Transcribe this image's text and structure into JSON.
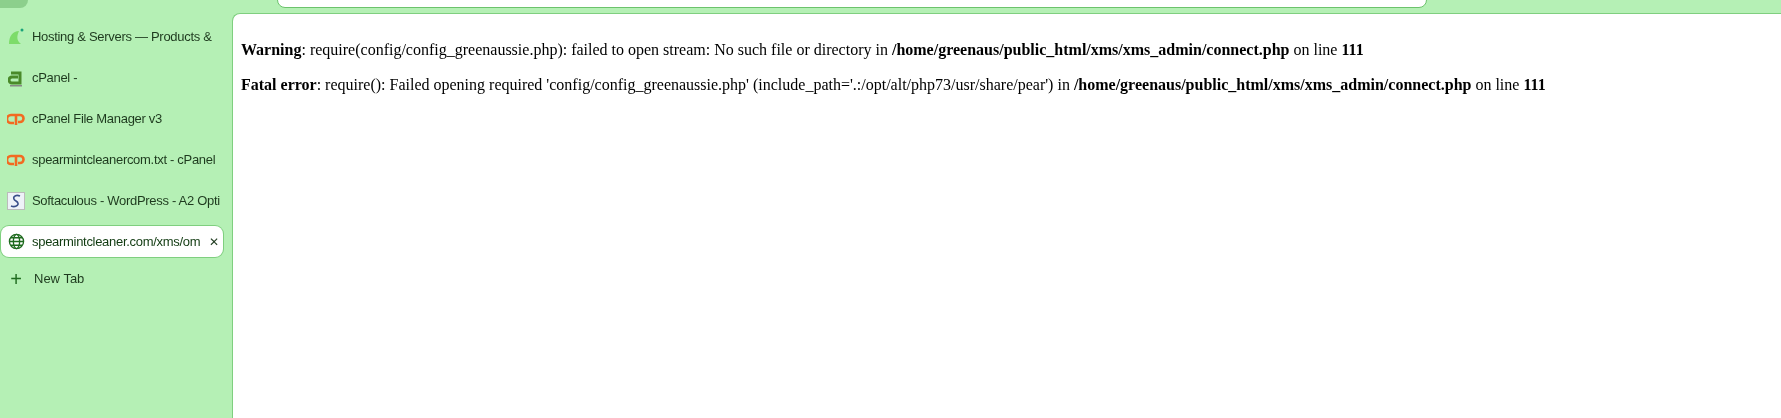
{
  "tabs": [
    {
      "title": "Hosting & Servers — Products &",
      "selected": false
    },
    {
      "title": "cPanel -",
      "selected": false
    },
    {
      "title": "cPanel File Manager v3",
      "selected": false
    },
    {
      "title": "spearmintcleanercom.txt - cPanel",
      "selected": false
    },
    {
      "title": "Softaculous - WordPress - A2 Opti",
      "selected": false
    },
    {
      "title": "spearmintcleaner.com/xms/om",
      "selected": true,
      "close": "✕"
    }
  ],
  "new_tab": {
    "icon": "+",
    "label": "New Tab"
  },
  "page": {
    "messages": [
      "**Warning**: require(config/config_greenaussie.php): failed to open stream: No such file or directory in **/home/greenaus/public_html/xms/xms_admin/connect.php** on line **111**",
      "**Fatal error**: require(): Failed opening required 'config/config_greenaussie.php' (include_path='.:/opt/alt/php73/usr/share/pear') in **/home/greenaus/public_html/xms/xms_admin/connect.php** on line **111**"
    ]
  }
}
